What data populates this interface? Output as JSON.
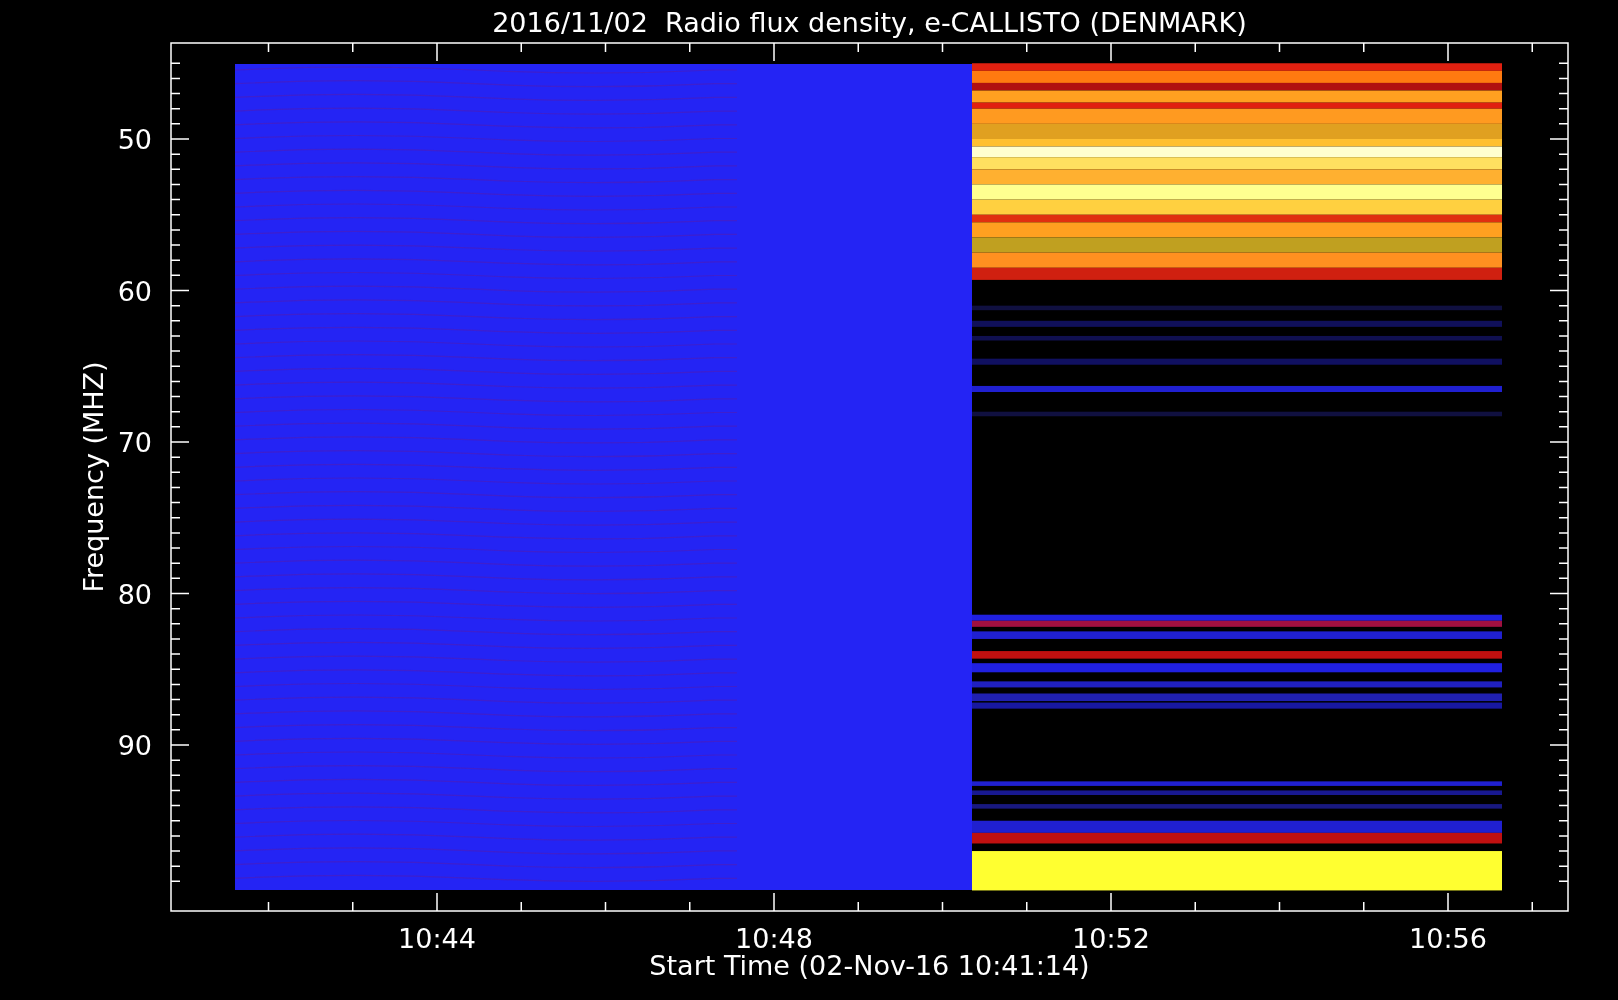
{
  "title": "2016/11/02  Radio flux density, e-CALLISTO (DENMARK)",
  "plot": {
    "ylabel": "Frequency (MHZ)",
    "xlabel": "Start Time (02-Nov-16 10:41:14)",
    "yticks": [
      "50",
      "60",
      "70",
      "80",
      "90"
    ],
    "xticks": [
      "10:44",
      "10:48",
      "10:52",
      "10:56"
    ]
  }
}
